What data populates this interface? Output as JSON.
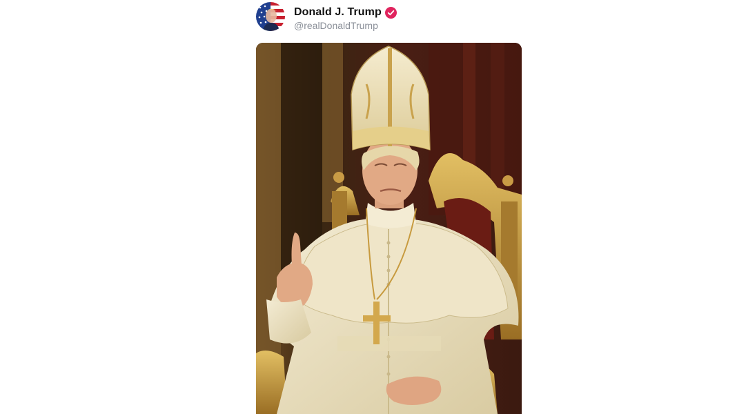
{
  "post": {
    "author": {
      "display_name": "Donald J. Trump",
      "handle": "@realDonaldTrump",
      "verified": true,
      "verified_badge_color": "#e0245e",
      "avatar_icon": "american-flag-portrait-avatar"
    },
    "media": {
      "type": "image",
      "icon": "ai-generated-portrait-image"
    }
  },
  "colors": {
    "background": "#ffffff",
    "name_text": "#111111",
    "handle_text": "#8a8f98"
  }
}
